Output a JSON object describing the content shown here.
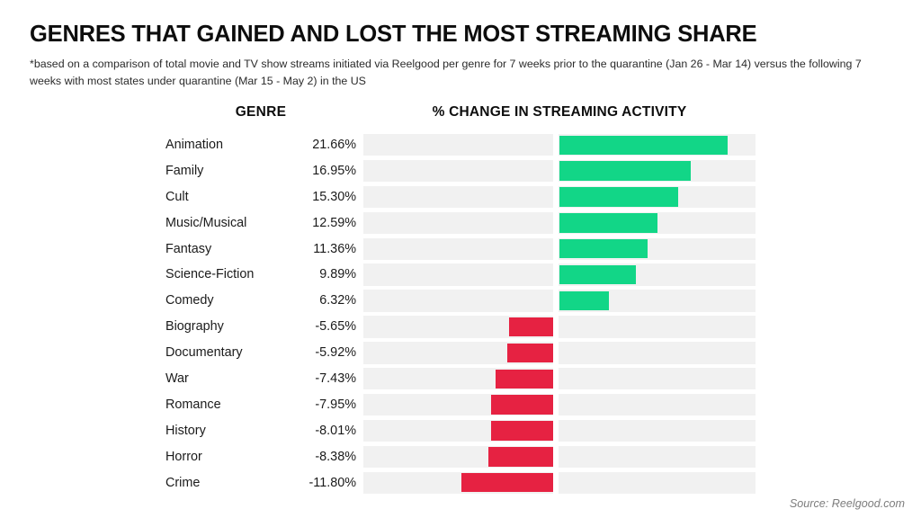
{
  "header": {
    "title": "GENRES THAT GAINED AND LOST THE MOST STREAMING SHARE",
    "subtitle": "*based on a comparison of total movie and TV show streams initiated via Reelgood per genre for 7 weeks prior to the quarantine (Jan 26 - Mar 14) versus the following 7 weeks with most states under quarantine (Mar 15 - May 2) in the US"
  },
  "columns": {
    "genre": "GENRE",
    "activity": "% CHANGE IN STREAMING ACTIVITY"
  },
  "source": {
    "label": "Source: Reelgood.com"
  },
  "colors": {
    "positive": "#12d687",
    "negative": "#e62242",
    "track": "#f1f1f1",
    "background": "#ffffff",
    "text": "#1b1b1b",
    "source_text": "#7d7d7d"
  },
  "chart_data": {
    "type": "bar",
    "orientation": "horizontal",
    "title": "GENRES THAT GAINED AND LOST THE MOST STREAMING SHARE",
    "subtitle": "*based on a comparison of total movie and TV show streams initiated via Reelgood per genre for 7 weeks prior to the quarantine (Jan 26 - Mar 14) versus the following 7 weeks with most states under quarantine (Mar 15 - May 2) in the US",
    "xlabel": "% CHANGE IN STREAMING ACTIVITY",
    "ylabel": "GENRE",
    "grid": false,
    "legend": false,
    "xlim": [
      -12.5,
      25.0
    ],
    "categories": [
      "Animation",
      "Family",
      "Cult",
      "Music/Musical",
      "Fantasy",
      "Science-Fiction",
      "Comedy",
      "Biography",
      "Documentary",
      "War",
      "Romance",
      "History",
      "Horror",
      "Crime"
    ],
    "values": [
      21.66,
      16.95,
      15.3,
      12.59,
      11.36,
      9.89,
      6.32,
      -5.65,
      -5.92,
      -7.43,
      -7.95,
      -8.01,
      -8.38,
      -11.8
    ],
    "value_labels": [
      "21.66%",
      "16.95%",
      "15.30%",
      "12.59%",
      "11.36%",
      "9.89%",
      "6.32%",
      "-5.65%",
      "-5.92%",
      "-7.43%",
      "-7.95%",
      "-8.01%",
      "-8.38%",
      "-11.80%"
    ],
    "rows": [
      {
        "genre": "Animation",
        "value": 21.66,
        "label": "21.66%",
        "sign": "positive"
      },
      {
        "genre": "Family",
        "value": 16.95,
        "label": "16.95%",
        "sign": "positive"
      },
      {
        "genre": "Cult",
        "value": 15.3,
        "label": "15.30%",
        "sign": "positive"
      },
      {
        "genre": "Music/Musical",
        "value": 12.59,
        "label": "12.59%",
        "sign": "positive"
      },
      {
        "genre": "Fantasy",
        "value": 11.36,
        "label": "11.36%",
        "sign": "positive"
      },
      {
        "genre": "Science-Fiction",
        "value": 9.89,
        "label": "9.89%",
        "sign": "positive"
      },
      {
        "genre": "Comedy",
        "value": 6.32,
        "label": "6.32%",
        "sign": "positive"
      },
      {
        "genre": "Biography",
        "value": -5.65,
        "label": "-5.65%",
        "sign": "negative"
      },
      {
        "genre": "Documentary",
        "value": -5.92,
        "label": "-5.92%",
        "sign": "negative"
      },
      {
        "genre": "War",
        "value": -7.43,
        "label": "-7.43%",
        "sign": "negative"
      },
      {
        "genre": "Romance",
        "value": -7.95,
        "label": "-7.95%",
        "sign": "negative"
      },
      {
        "genre": "History",
        "value": -8.01,
        "label": "-8.01%",
        "sign": "negative"
      },
      {
        "genre": "Horror",
        "value": -8.38,
        "label": "-8.38%",
        "sign": "negative"
      },
      {
        "genre": "Crime",
        "value": -11.8,
        "label": "-11.80%",
        "sign": "negative"
      }
    ]
  }
}
